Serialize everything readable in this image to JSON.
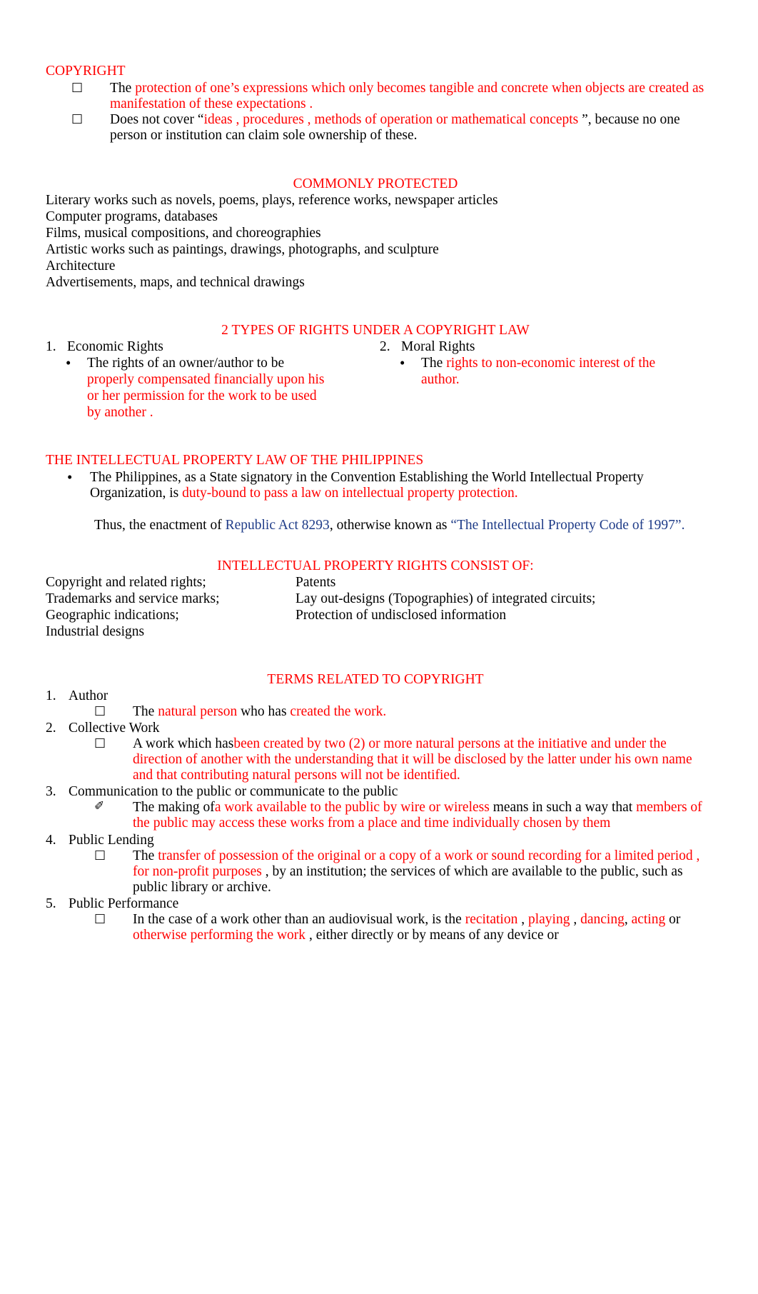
{
  "document": {
    "title": "COPYRIGHT",
    "colors": {
      "accent_red": "#FF0000",
      "accent_blue": "#1F3C88",
      "body": "#000000"
    }
  },
  "copyright_section": {
    "heading": "COPYRIGHT",
    "bullets": [
      {
        "marker": "§",
        "parts": [
          {
            "text": "The ",
            "color": "black"
          },
          {
            "text": "protection of one’s expressions which only becomes tangible and concrete when objects are created as manifestation of these expectations",
            "color": "red"
          },
          {
            "text": "    .",
            "color": "red"
          }
        ]
      },
      {
        "marker": "§",
        "parts": [
          {
            "text": "Does not cover “",
            "color": "black"
          },
          {
            "text": "ideas , procedures , methods of operation or mathematical concepts",
            "color": "red"
          },
          {
            "text": "   ”, because no one person or institution can claim sole ownership of these.",
            "color": "black"
          }
        ]
      }
    ]
  },
  "commonly_protected": {
    "heading": "COMMONLY PROTECTED",
    "items": [
      "Literary works such as novels, poems, plays, reference works, newspaper articles",
      "Computer programs, databases",
      "Films, musical compositions, and choreographies",
      "Artistic works such as paintings, drawings, photographs, and sculpture",
      "Architecture",
      "Advertisements, maps, and technical drawings"
    ]
  },
  "types_of_rights": {
    "heading": "2 TYPES OF RIGHTS UNDER A COPYRIGHT LAW",
    "columns": [
      {
        "number": "1.",
        "title": "Economic Rights",
        "bullet_marker": "•",
        "parts": [
          {
            "text": "The rights of an owner/author to be ",
            "color": "black"
          },
          {
            "text": "properly compensated financially upon his or her permission for the work to be used by another",
            "color": "red"
          },
          {
            "text": " .",
            "color": "red"
          }
        ]
      },
      {
        "number": "2.",
        "title": "Moral Rights",
        "bullet_marker": "•",
        "parts": [
          {
            "text": "The ",
            "color": "black"
          },
          {
            "text": "rights to non-economic interest of the author.",
            "color": "red"
          }
        ]
      }
    ]
  },
  "ip_law": {
    "heading": "THE INTELLECTUAL PROPERTY LAW OF THE PHILIPPINES",
    "bullet_marker": "•",
    "bullet_parts": [
      {
        "text": "The Philippines, as a State signatory in the Convention Establishing the World Intellectual Property Organization, is ",
        "color": "black"
      },
      {
        "text": "duty-bound to pass a law on intellectual property protection.",
        "color": "red"
      }
    ],
    "paragraph_parts": [
      {
        "text": "Thus, the enactment of  ",
        "color": "black"
      },
      {
        "text": "Republic Act 8293",
        "color": "blue"
      },
      {
        "text": ", otherwise known as ",
        "color": "black"
      },
      {
        "text": "“The Intellectual Property Code of 1997”.",
        "color": "blue"
      }
    ]
  },
  "ip_rights": {
    "heading": "INTELLECTUAL PROPERTY RIGHTS CONSIST OF:",
    "rows": [
      {
        "left": "Copyright and related rights;",
        "right": "Patents"
      },
      {
        "left": "Trademarks and service marks;",
        "right": "Lay out-designs (Topographies) of integrated circuits;"
      },
      {
        "left": "Geographic indications;",
        "right": "Protection of undisclosed information"
      },
      {
        "left": "Industrial designs",
        "right": ""
      }
    ]
  },
  "terms": {
    "heading": "TERMS RELATED TO COPYRIGHT",
    "items": [
      {
        "number": "1.",
        "title": "Author",
        "sub_marker": "§",
        "sub_parts": [
          {
            "text": "The ",
            "color": "black"
          },
          {
            "text": "natural person",
            "color": "red"
          },
          {
            "text": "  who has ",
            "color": "black"
          },
          {
            "text": "created the work.",
            "color": "red"
          }
        ]
      },
      {
        "number": "2.",
        "title": "Collective Work",
        "sub_marker": "§",
        "sub_parts": [
          {
            "text": "A work which has",
            "color": "black"
          },
          {
            "text": "been  created by two (2) or more natural persons at the initiative",
            "color": "red"
          },
          {
            "text": "    and under the direction of another with the understanding that it will be disclosed by the latter under his own name",
            "color": "red"
          },
          {
            "text": "   and that  contributing natural persons will not be identified.",
            "color": "red"
          }
        ]
      },
      {
        "number": "3.",
        "title": "Communication to the public or communicate to the public",
        "sub_marker": "✐",
        "sub_parts": [
          {
            "text": "The making of",
            "color": "black"
          },
          {
            "text": "a work available to the public by wire or wireless",
            "color": "red"
          },
          {
            "text": "   means in such a way that ",
            "color": "black"
          },
          {
            "text": "members of the public may access these works from a place and time individually chosen by them",
            "color": "red"
          }
        ]
      },
      {
        "number": "4.",
        "title": "Public Lending",
        "sub_marker": "§",
        "sub_parts": [
          {
            "text": "The ",
            "color": "black"
          },
          {
            "text": "transfer of possession of the original",
            "color": "red"
          },
          {
            "text": "  or a copy of a work or sound recording for a limited period , for non-profit purposes",
            "color": "red"
          },
          {
            "text": " , by an institution; the services of which are available to the public, such as public library or archive.",
            "color": "black"
          }
        ]
      },
      {
        "number": "5.",
        "title": "Public Performance",
        "sub_marker": "§",
        "sub_parts": [
          {
            "text": "In the case of a work other than an audiovisual work, is the ",
            "color": "black"
          },
          {
            "text": " recitation",
            "color": "red"
          },
          {
            "text": " , ",
            "color": "black"
          },
          {
            "text": "playing",
            "color": "red"
          },
          {
            "text": " , ",
            "color": "black"
          },
          {
            "text": "dancing",
            "color": "red"
          },
          {
            "text": ", ",
            "color": "black"
          },
          {
            "text": "acting",
            "color": "red"
          },
          {
            "text": "  or ",
            "color": "black"
          },
          {
            "text": "otherwise performing the work",
            "color": "red"
          },
          {
            "text": "  , either directly or by means of any device or",
            "color": "black"
          }
        ]
      }
    ]
  }
}
